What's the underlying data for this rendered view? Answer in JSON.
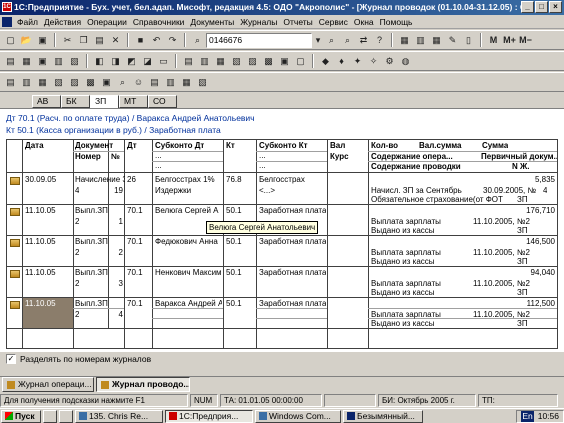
{
  "window": {
    "title": "1С:Предприятие - Бух. учет, бел.адап. Мисофт, редакция 4.5: ОДО \"Акрополис\" - [Журнал проводок (01.10.04-31.12.05) : О..."
  },
  "menu": [
    "Файл",
    "Действия",
    "Операции",
    "Справочники",
    "Документы",
    "Журналы",
    "Отчеты",
    "Сервис",
    "Окна",
    "Помощь"
  ],
  "toolbar": {
    "search_value": "0146676",
    "m_label": "M",
    "mplus_label": "M+",
    "mminus_label": "M−"
  },
  "tabs": [
    "АВ",
    "БК",
    "ЗП",
    "МТ",
    "СО"
  ],
  "active_tab": "ЗП",
  "account_info": {
    "debit": "Дт 70.1 (Расч. по оплате труда) / Варакса Андрей Анатольевич",
    "credit": "Кт 50.1 (Касса организации в руб.) / Заработная плата"
  },
  "columns": {
    "date": "Дата",
    "document": "Документ",
    "number": "Номер",
    "no": "№",
    "dt": "Дт",
    "subkonto_dt": "Субконто Дт",
    "kt": "Кт",
    "subkonto_kt": "Субконто Кт",
    "val": "Вал",
    "rate": "Курс",
    "qty": "Кол-во",
    "val_sum": "Вал.сумма",
    "sum": "Сумма",
    "op_content": "Содержание опера...",
    "primary_doc": "Первичный докум...",
    "entry_content": "Содержание проводки",
    "nzh": "N Ж.",
    "dots": "..."
  },
  "rows": [
    {
      "date": "30.09.05",
      "doc": "Начисление З",
      "doc_num": "4",
      "line": "19",
      "dt": "26",
      "sub_dt": "Белгосстрах 1%",
      "sub_dt2": "Издержки",
      "kt": "76.8",
      "sub_kt": "Белгосстрах",
      "sub_kt2": "<...>",
      "sum": "5,835",
      "op": "Начисл. ЗП за Сентябрь",
      "pdoc": "30.09.2005, №",
      "nzh_val": "4",
      "entry": "Обязательное страхование(от ФОТ",
      "entry_j": "ЗП"
    },
    {
      "date": "11.10.05",
      "doc": "Выпл.ЗП",
      "doc_num": "2",
      "line": "1",
      "dt": "70.1",
      "sub_dt": "Велюга Сергей А",
      "kt": "50.1",
      "sub_kt": "Заработная плата",
      "sum": "176,710",
      "op": "Выплата зарплаты",
      "pdoc": "11.10.2005, №2",
      "entry": "Выдано из кассы",
      "entry_j": "ЗП"
    },
    {
      "date": "11.10.05",
      "doc": "Выпл.ЗП",
      "doc_num": "2",
      "line": "2",
      "dt": "70.1",
      "sub_dt": "Федюкович Анна",
      "kt": "50.1",
      "sub_kt": "Заработная плата",
      "sum": "146,500",
      "op": "Выплата зарплаты",
      "pdoc": "11.10.2005, №2",
      "entry": "Выдано из кассы",
      "entry_j": "ЗП"
    },
    {
      "date": "11.10.05",
      "doc": "Выпл.ЗП",
      "doc_num": "2",
      "line": "3",
      "dt": "70.1",
      "sub_dt": "Ненкович Максим",
      "kt": "50.1",
      "sub_kt": "Заработная плата",
      "sum": "94,040",
      "op": "Выплата зарплаты",
      "pdoc": "11.10.2005, №2",
      "entry": "Выдано из кассы",
      "entry_j": "ЗП"
    },
    {
      "date": "11.10.05",
      "doc": "Выпл.ЗП",
      "doc_num": "2",
      "line": "4",
      "dt": "70.1",
      "sub_dt": "Варакса Андрей А",
      "kt": "50.1",
      "sub_kt": "Заработная плата",
      "sum": "112,500",
      "op": "Выплата зарплаты",
      "pdoc": "11.10.2005, №2",
      "entry": "Выдано из кассы",
      "entry_j": "ЗП"
    }
  ],
  "tooltip": "Велюга Сергей Анатольевич",
  "checkbox_label": "Разделять по номерам журналов",
  "window_tabs": [
    "Журнал операци...",
    "Журнал проводо..."
  ],
  "status": {
    "hint": "Для получения подсказки нажмите F1",
    "num": "NUM",
    "ta": "ТА: 01.01.05 00:00:00",
    "bi": "БИ: Октябрь 2005 г.",
    "tp": "ТП:"
  },
  "taskbar": {
    "start": "Пуск",
    "items": [
      "135. Chris Re...",
      "1С:Предприя...",
      "Windows Com...",
      "Безымянный..."
    ],
    "lang": "En",
    "time": "10:56"
  }
}
